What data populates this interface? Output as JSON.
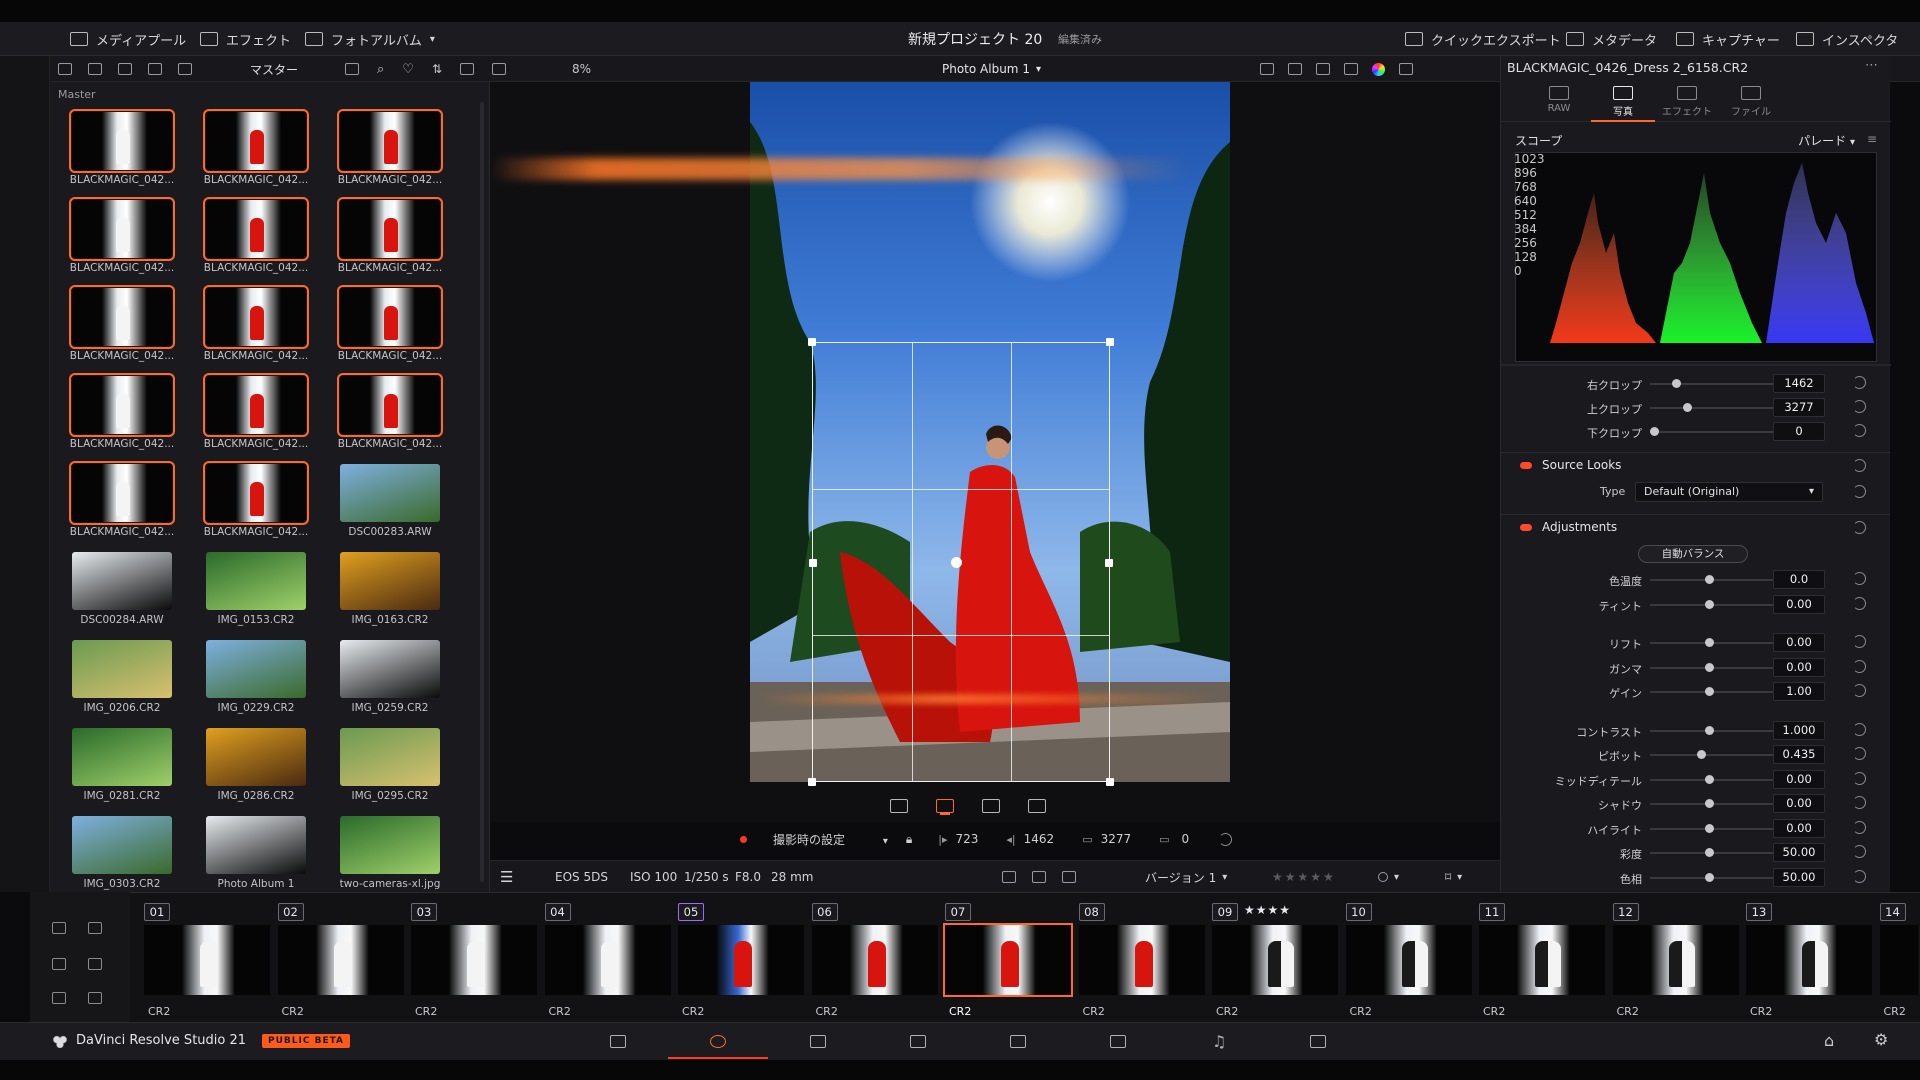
{
  "topbar": {
    "media_pool": "メディアプール",
    "effects": "エフェクト",
    "photo_album": "フォトアルバム",
    "project_title": "新規プロジェクト 20",
    "edit_status": "編集済み",
    "quick_export": "クイックエクスポート",
    "metadata": "メタデータ",
    "capture": "キャプチャー",
    "inspector": "インスペクタ"
  },
  "toolbar": {
    "master": "マスター",
    "zoom": "8%",
    "album_name": "Photo Album 1",
    "filename": "BLACKMAGIC_0426_Dress 2_6158.CR2"
  },
  "media_pool": {
    "folder": "Master",
    "items": [
      {
        "label": "BLACKMAGIC_042...",
        "selected": true
      },
      {
        "label": "BLACKMAGIC_042...",
        "selected": true
      },
      {
        "label": "BLACKMAGIC_042...",
        "selected": true
      },
      {
        "label": "BLACKMAGIC_042...",
        "selected": true
      },
      {
        "label": "BLACKMAGIC_042...",
        "selected": true
      },
      {
        "label": "BLACKMAGIC_042...",
        "selected": true
      },
      {
        "label": "BLACKMAGIC_042...",
        "selected": true
      },
      {
        "label": "BLACKMAGIC_042...",
        "selected": true
      },
      {
        "label": "BLACKMAGIC_042...",
        "selected": true
      },
      {
        "label": "BLACKMAGIC_042...",
        "selected": true
      },
      {
        "label": "BLACKMAGIC_042...",
        "selected": true
      },
      {
        "label": "BLACKMAGIC_042...",
        "selected": true
      },
      {
        "label": "BLACKMAGIC_042...",
        "selected": true
      },
      {
        "label": "BLACKMAGIC_042...",
        "selected": true
      },
      {
        "label": "DSC00283.ARW",
        "selected": false
      },
      {
        "label": "DSC00284.ARW",
        "selected": false
      },
      {
        "label": "IMG_0153.CR2",
        "selected": false
      },
      {
        "label": "IMG_0163.CR2",
        "selected": false
      },
      {
        "label": "IMG_0206.CR2",
        "selected": false
      },
      {
        "label": "IMG_0229.CR2",
        "selected": false
      },
      {
        "label": "IMG_0259.CR2",
        "selected": false
      },
      {
        "label": "IMG_0281.CR2",
        "selected": false
      },
      {
        "label": "IMG_0286.CR2",
        "selected": false
      },
      {
        "label": "IMG_0295.CR2",
        "selected": false
      },
      {
        "label": "IMG_0303.CR2",
        "selected": false
      },
      {
        "label": "Photo Album 1",
        "selected": false
      },
      {
        "label": "two-cameras-xl.jpg",
        "selected": false
      }
    ]
  },
  "crop_bar": {
    "camera_setting": "撮影時の設定",
    "left": "723",
    "right": "1462",
    "top": "3277",
    "bottom": "0"
  },
  "info_bar": {
    "camera": "EOS 5DS",
    "iso": "ISO 100",
    "shutter": "1/250 s",
    "aperture": "F8.0",
    "focal": "28 mm",
    "version": "バージョン 1"
  },
  "inspector": {
    "tabs": [
      {
        "label": "RAW",
        "active": false
      },
      {
        "label": "写真",
        "active": true
      },
      {
        "label": "エフェクト",
        "active": false
      },
      {
        "label": "ファイル",
        "active": false
      }
    ],
    "scope_title": "スコープ",
    "scope_mode": "パレード",
    "scope_ticks": [
      "1023",
      "896",
      "768",
      "640",
      "512",
      "384",
      "256",
      "128",
      "0"
    ],
    "crop_params": [
      {
        "label": "右クロップ",
        "value": "1462",
        "pos": 0.2
      },
      {
        "label": "上クロップ",
        "value": "3277",
        "pos": 0.3
      },
      {
        "label": "下クロップ",
        "value": "0",
        "pos": 0.0
      }
    ],
    "source_looks": "Source Looks",
    "type_label": "Type",
    "type_value": "Default (Original)",
    "adjustments": "Adjustments",
    "auto_balance": "自動バランス",
    "adjust_params": [
      {
        "label": "色温度",
        "value": "0.0",
        "pos": 0.5
      },
      {
        "label": "ティント",
        "value": "0.00",
        "pos": 0.5
      },
      {
        "label": "リフト",
        "value": "0.00",
        "pos": 0.5
      },
      {
        "label": "ガンマ",
        "value": "0.00",
        "pos": 0.5
      },
      {
        "label": "ゲイン",
        "value": "1.00",
        "pos": 0.5
      },
      {
        "label": "コントラスト",
        "value": "1.000",
        "pos": 0.5
      },
      {
        "label": "ピボット",
        "value": "0.435",
        "pos": 0.43
      },
      {
        "label": "ミッドディテール",
        "value": "0.00",
        "pos": 0.5
      },
      {
        "label": "シャドウ",
        "value": "0.00",
        "pos": 0.5
      },
      {
        "label": "ハイライト",
        "value": "0.00",
        "pos": 0.5
      },
      {
        "label": "彩度",
        "value": "50.00",
        "pos": 0.5
      },
      {
        "label": "色相",
        "value": "50.00",
        "pos": 0.5
      }
    ]
  },
  "timeline": {
    "clips": [
      {
        "num": "01",
        "cap": "CR2"
      },
      {
        "num": "02",
        "cap": "CR2"
      },
      {
        "num": "03",
        "cap": "CR2"
      },
      {
        "num": "04",
        "cap": "CR2"
      },
      {
        "num": "05",
        "cap": "CR2"
      },
      {
        "num": "06",
        "cap": "CR2"
      },
      {
        "num": "07",
        "cap": "CR2"
      },
      {
        "num": "08",
        "cap": "CR2"
      },
      {
        "num": "09",
        "cap": "CR2",
        "stars": "★★★★"
      },
      {
        "num": "10",
        "cap": "CR2"
      },
      {
        "num": "11",
        "cap": "CR2"
      },
      {
        "num": "12",
        "cap": "CR2"
      },
      {
        "num": "13",
        "cap": "CR2"
      },
      {
        "num": "14",
        "cap": "CR2"
      }
    ]
  },
  "bottom": {
    "app_name": "DaVinci Resolve Studio 21",
    "beta": "PUBLIC BETA"
  },
  "colors": {
    "accent": "#ff6a2a",
    "panel": "#1a1a1e",
    "red_dress": "#d8140e"
  }
}
